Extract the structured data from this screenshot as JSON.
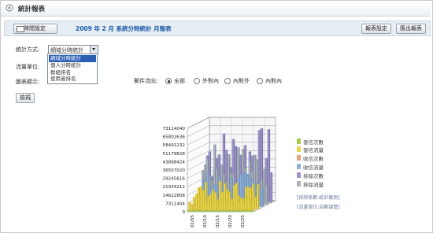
{
  "header": {
    "title": "統計報表"
  },
  "toolbar": {
    "time_button": "時間設定",
    "report_title": "2009 年 2 月 系統分時統計 月報表",
    "settings_button": "報表設定",
    "export_button": "匯出報表"
  },
  "form": {
    "method_label": "統計方式:",
    "selected_method": "網域分時統計",
    "unit_label": "流量單位:",
    "display_label": "圖表顯示:",
    "options": [
      "網域分時統計",
      "個人分時統計",
      "群組排名",
      "使用者排名"
    ],
    "direction_label": "郵件流向:",
    "directions": [
      "全部",
      "外對內",
      "內對外",
      "內對內"
    ],
    "selected_direction": "全部",
    "query_button": "檢視"
  },
  "chart_data": {
    "type": "bar",
    "y_ticks": [
      "73114040",
      "65802636",
      "58491232",
      "51179828",
      "43868424",
      "36557020",
      "29245616",
      "21934212",
      "14622808",
      "7311404",
      "0"
    ],
    "x_ticks": [
      "02/05",
      "02/10",
      "02/15",
      "02/20",
      "02/25"
    ],
    "ylim": [
      0,
      73114040
    ],
    "series": [
      {
        "name": "發信次數",
        "color": "#a8c84a"
      },
      {
        "name": "發信流量",
        "color": "#e8d44d"
      },
      {
        "name": "收信次數",
        "color": "#e6a07a"
      },
      {
        "name": "收信流量",
        "color": "#8fb0d8"
      },
      {
        "name": "排除次數",
        "color": "#9c94c8"
      },
      {
        "name": "排除流量",
        "color": "#a9b2bc"
      }
    ]
  },
  "notes": [
    "[排除係數:統計範例]",
    "[流量單位:自動調整]"
  ]
}
